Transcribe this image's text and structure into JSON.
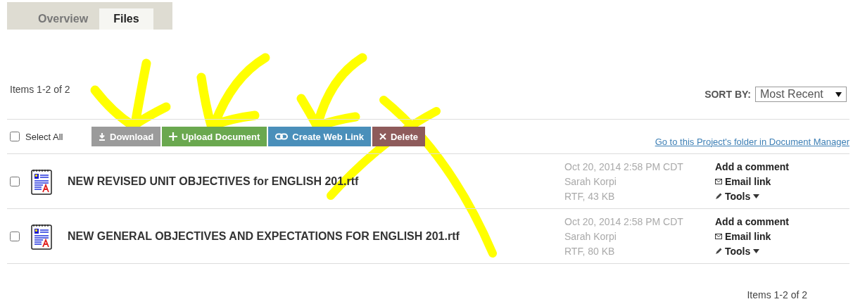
{
  "tabs": [
    {
      "label": "Overview",
      "selected": false
    },
    {
      "label": "Files",
      "selected": true
    }
  ],
  "summary": "Items 1-2 of 2",
  "sort": {
    "label": "SORT BY:",
    "value": "Most Recent"
  },
  "select_all": {
    "label": "Select All",
    "checked": false
  },
  "toolbar": [
    {
      "kind": "download",
      "label": "Download"
    },
    {
      "kind": "upload",
      "label": "Upload Document"
    },
    {
      "kind": "link",
      "label": "Create Web Link"
    },
    {
      "kind": "delete",
      "label": "Delete"
    }
  ],
  "folder_link": "Go to this Project's folder in Document Manager",
  "files": [
    {
      "name": "NEW REVISED UNIT OBJECTIVES for ENGLISH 201.rtf",
      "checked": false,
      "date": "Oct 20, 2014 2:58 PM CDT",
      "author": "Sarah Korpi",
      "size": "RTF, 43 KB",
      "comment": "Add a comment",
      "email": "Email link",
      "tools": "Tools"
    },
    {
      "name": "NEW GENERAL OBJECTIVES AND EXPECTATIONS FOR ENGLISH 201.rtf",
      "checked": false,
      "date": "Oct 20, 2014 2:58 PM CDT",
      "author": "Sarah Korpi",
      "size": "RTF, 80 KB",
      "comment": "Add a comment",
      "email": "Email link",
      "tools": "Tools"
    }
  ],
  "footer": "Items 1-2 of 2"
}
